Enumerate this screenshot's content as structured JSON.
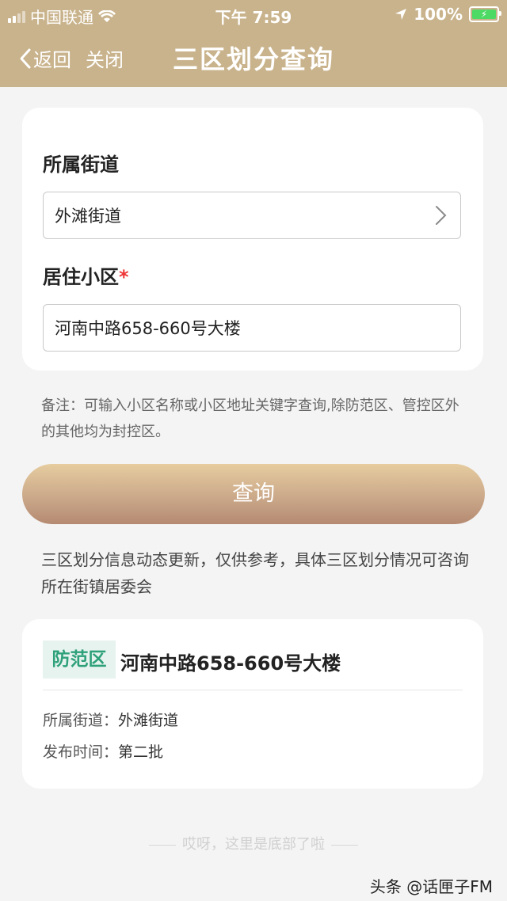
{
  "status_bar": {
    "carrier": "中国联通",
    "time": "下午 7:59",
    "battery": "100%"
  },
  "nav": {
    "back_label": "返回",
    "close_label": "关闭",
    "title": "三区划分查询"
  },
  "form": {
    "street_label": "所属街道",
    "street_value": "外滩街道",
    "community_label": "居住小区",
    "required_mark": "*",
    "community_value": "河南中路658-660号大楼"
  },
  "note": "备注：可输入小区名称或小区地址关键字查询,除防范区、管控区外的其他均为封控区。",
  "query_button": "查询",
  "info": "三区划分信息动态更新，仅供参考，具体三区划分情况可咨询所在街镇居委会",
  "result": {
    "badge": "防范区",
    "address": "河南中路658-660号大楼",
    "street_label": "所属街道：",
    "street_value": "外滩街道",
    "release_label": "发布时间：",
    "release_value": "第二批"
  },
  "footer_text": "哎呀，这里是底部了啦",
  "watermark": "头条 @话匣子FM",
  "colors": {
    "header": "#c9b38c",
    "badge_text": "#2ea07a",
    "badge_bg": "#e7f3ee"
  }
}
